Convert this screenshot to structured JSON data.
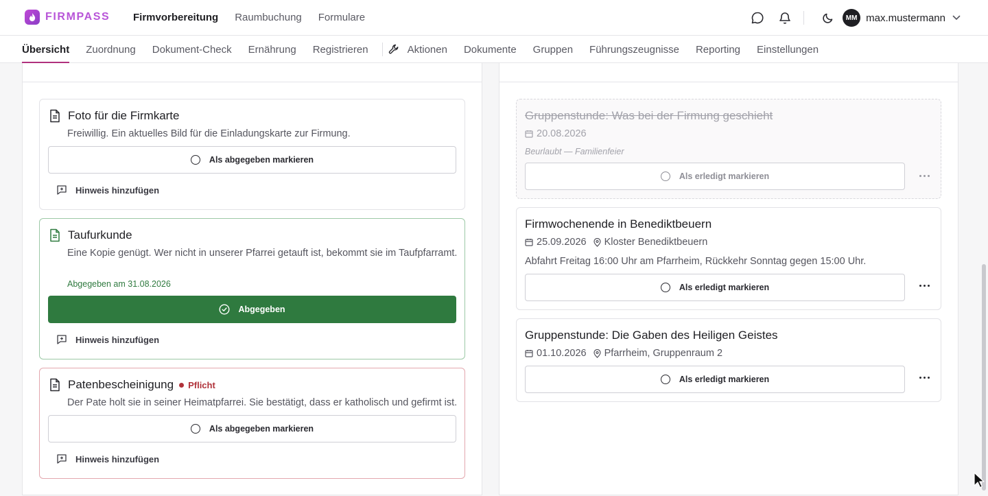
{
  "brand": {
    "name": "FIRMPASS",
    "color": "#b855d8"
  },
  "main_nav": [
    "Firmvorbereitung",
    "Raumbuchung",
    "Formulare"
  ],
  "user": {
    "initials": "MM",
    "name": "max.mustermann"
  },
  "tabs": [
    "Übersicht",
    "Zuordnung",
    "Dokument-Check",
    "Ernährung",
    "Registrieren",
    "Aktionen",
    "Dokumente",
    "Gruppen",
    "Führungszeugnisse",
    "Reporting",
    "Einstellungen"
  ],
  "documents": [
    {
      "title": "Foto für die Firmkarte",
      "desc": "Freiwillig. Ein aktuelles Bild für die Einladungskarte zur Firmung.",
      "button": "Als abgegeben markieren",
      "hint": "Hinweis hinzufügen"
    },
    {
      "title": "Taufurkunde",
      "desc": "Eine Kopie genügt. Wer nicht in unserer Pfarrei getauft ist, bekommt sie im Taufpfarramt.",
      "submitted_note": "Abgegeben am 31.08.2026",
      "button": "Abgegeben",
      "hint": "Hinweis hinzufügen"
    },
    {
      "title": "Patenbescheinigung",
      "badge": "Pflicht",
      "desc": "Der Pate holt sie in seiner Heimatpfarrei. Sie bestätigt, dass er katholisch und gefirmt ist.",
      "button": "Als abgegeben markieren",
      "hint": "Hinweis hinzufügen"
    }
  ],
  "events": [
    {
      "title": "Gruppenstunde: Was bei der Firmung geschieht",
      "date": "20.08.2026",
      "excuse": "Beurlaubt — Familienfeier",
      "button": "Als erledigt markieren"
    },
    {
      "title": "Firmwochenende in Benediktbeuern",
      "date": "25.09.2026",
      "location": "Kloster Benediktbeuern",
      "note": "Abfahrt Freitag 16:00 Uhr am Pfarrheim, Rückkehr Sonntag gegen 15:00 Uhr.",
      "button": "Als erledigt markieren"
    },
    {
      "title": "Gruppenstunde: Die Gaben des Heiligen Geistes",
      "date": "01.10.2026",
      "location": "Pfarrheim, Gruppenraum 2",
      "button": "Als erledigt markieren"
    }
  ],
  "colors": {
    "submitted_green": "#2f7a3f",
    "required_red": "#b0323a",
    "tab_underline": "#b0317d"
  }
}
